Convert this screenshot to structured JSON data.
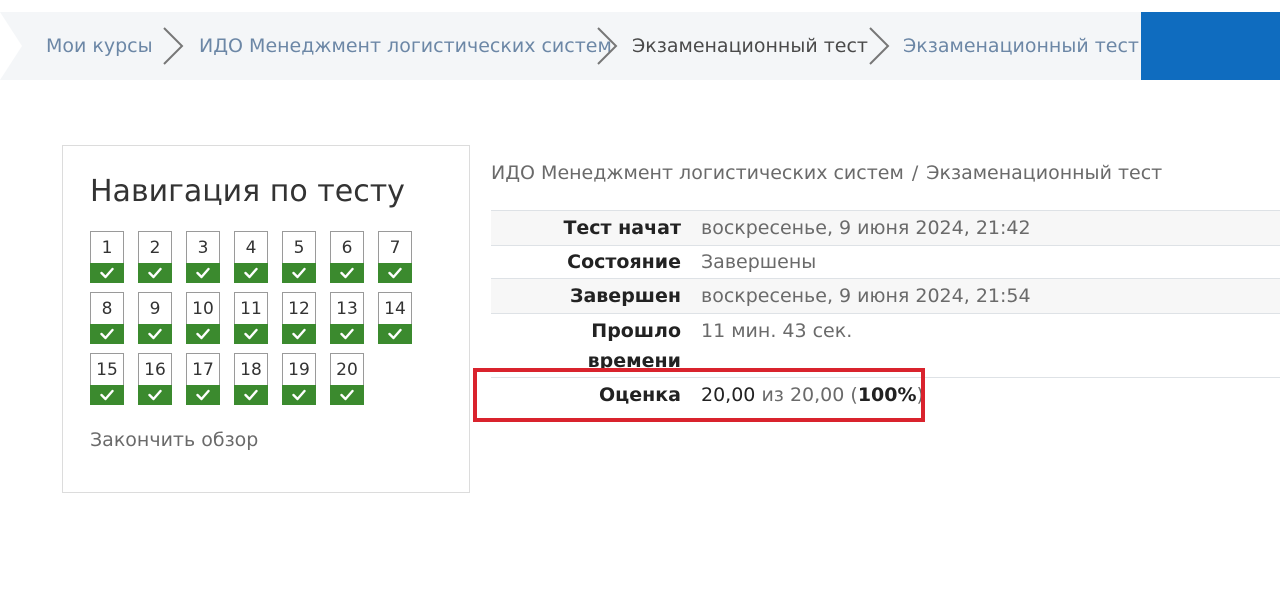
{
  "breadcrumbs": [
    {
      "label": "Мои курсы"
    },
    {
      "label": "ИДО Менеджмент логистических систем"
    },
    {
      "label": "Экзаменационный тест"
    },
    {
      "label": "Экзаменационный тест"
    }
  ],
  "nav": {
    "title": "Навигация по тесту",
    "questions": [
      "1",
      "2",
      "3",
      "4",
      "5",
      "6",
      "7",
      "8",
      "9",
      "10",
      "11",
      "12",
      "13",
      "14",
      "15",
      "16",
      "17",
      "18",
      "19",
      "20"
    ],
    "finish_label": "Закончить обзор"
  },
  "summary": {
    "course": "ИДО Менеджмент логистических систем",
    "separator": "/",
    "quiz": "Экзаменационный тест",
    "rows": [
      {
        "label": "Тест начат",
        "value": "воскресенье, 9 июня 2024, 21:42"
      },
      {
        "label": "Состояние",
        "value": "Завершены"
      },
      {
        "label": "Завершен",
        "value": "воскресенье, 9 июня 2024, 21:54"
      },
      {
        "label": "Прошло времени",
        "label_line1": "Прошло",
        "label_line2": "времени",
        "value": "11 мин. 43 сек."
      },
      {
        "label": "Оценка",
        "grade": "20,00",
        "of": "из",
        "max": "20,00",
        "percent_open": "(",
        "percent": "100%",
        "percent_close": ")"
      }
    ]
  },
  "colors": {
    "accent": "#0f6cbf",
    "correct": "#3b8a2e",
    "highlight": "#d9232d"
  }
}
